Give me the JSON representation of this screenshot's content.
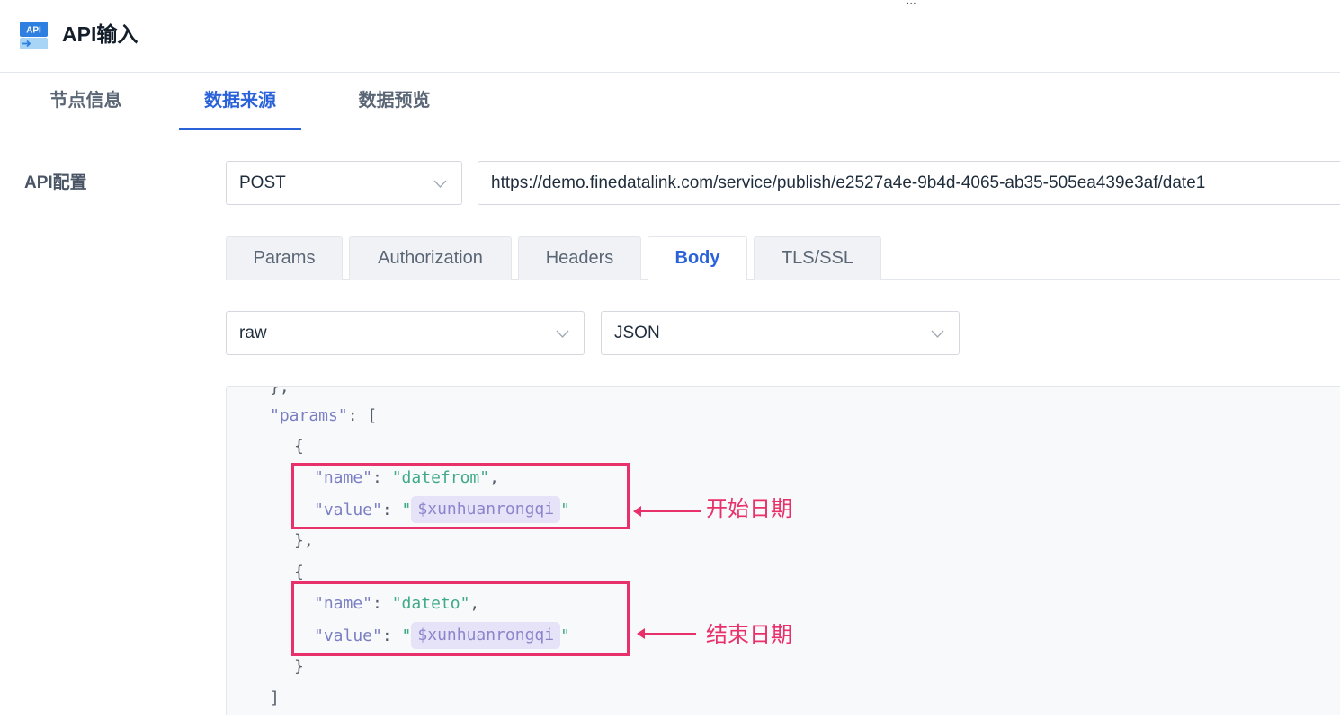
{
  "header": {
    "title": "API输入",
    "icon_text": "API",
    "stray_mark": "...",
    "icon": "api-input-icon"
  },
  "tabs": [
    {
      "label": "节点信息",
      "active": false
    },
    {
      "label": "数据来源",
      "active": true
    },
    {
      "label": "数据预览",
      "active": false
    }
  ],
  "api_config": {
    "label": "API配置",
    "method": "POST",
    "url": "https://demo.finedatalink.com/service/publish/e2527a4e-9b4d-4065-ab35-505ea439e3af/date1"
  },
  "subtabs": [
    {
      "label": "Params",
      "active": false
    },
    {
      "label": "Authorization",
      "active": false
    },
    {
      "label": "Headers",
      "active": false
    },
    {
      "label": "Body",
      "active": true
    },
    {
      "label": "TLS/SSL",
      "active": false
    }
  ],
  "body": {
    "body_type": "raw",
    "content_type": "JSON"
  },
  "code": {
    "partial_top": "},",
    "params_key": "\"params\"",
    "colon": ":",
    "open_bracket": "[",
    "close_bracket": "]",
    "open_brace": "{",
    "close_brace_comma": "},",
    "close_brace": "}",
    "name_key": "\"name\"",
    "value_key": "\"value\"",
    "quote": "\"",
    "comma": ",",
    "item1_name": "\"datefrom\"",
    "item1_value_var": "$xunhuanrongqi",
    "item2_name": "\"dateto\"",
    "item2_value_var": "$xunhuanrongqi"
  },
  "annotations": {
    "start_date": "开始日期",
    "end_date": "结束日期",
    "color": "#e8306a"
  },
  "colors": {
    "accent": "#2a63d9",
    "annotation": "#e8306a",
    "json_key": "#7a7fc2",
    "json_string": "#3fa98a"
  }
}
